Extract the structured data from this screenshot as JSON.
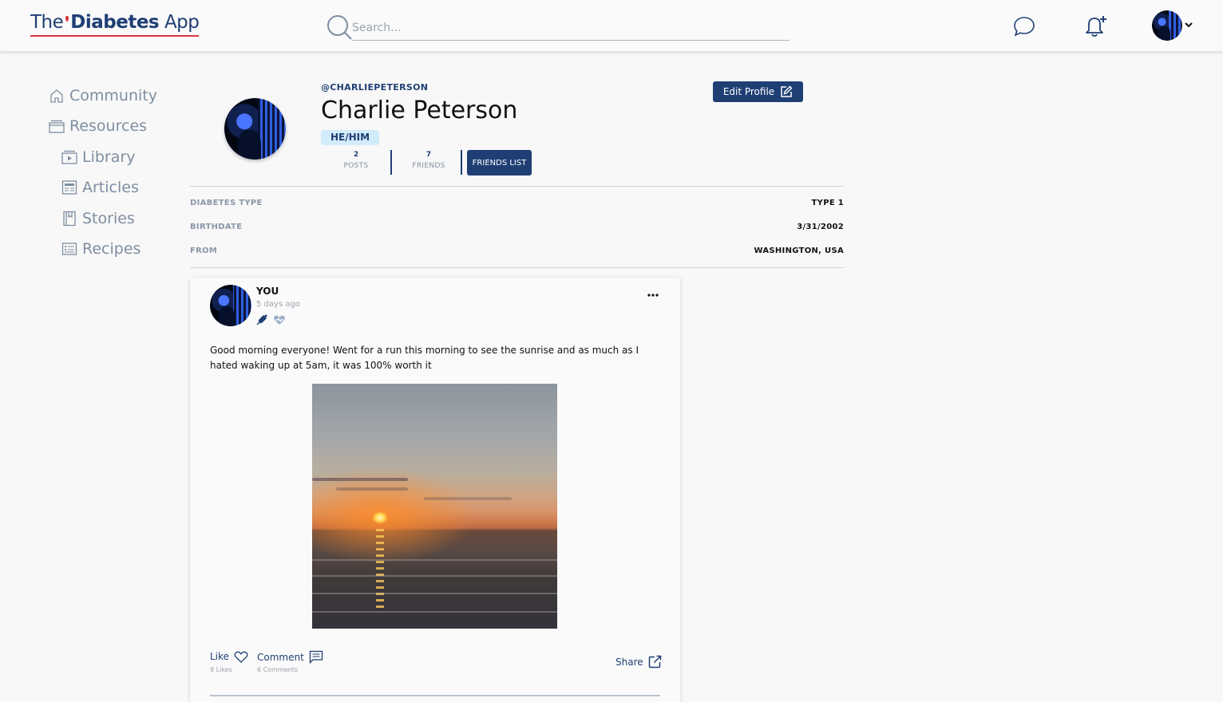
{
  "app": {
    "logo_the": "The",
    "logo_diabetes": "Diabetes",
    "logo_app": "App"
  },
  "search": {
    "placeholder": "Search..."
  },
  "sidebar": {
    "items": [
      {
        "label": "Community",
        "icon": "home-icon"
      },
      {
        "label": "Resources",
        "icon": "folder-icon"
      },
      {
        "label": "Library",
        "icon": "video-icon"
      },
      {
        "label": "Articles",
        "icon": "newspaper-icon"
      },
      {
        "label": "Stories",
        "icon": "book-icon"
      },
      {
        "label": "Recipes",
        "icon": "recipe-card-icon"
      }
    ]
  },
  "profile": {
    "handle": "@CHARLIEPETERSON",
    "name": "Charlie Peterson",
    "pronouns": "HE/HIM",
    "posts_count": "2",
    "posts_label": "POSTS",
    "friends_count": "7",
    "friends_label": "FRIENDS",
    "friends_list_label": "FRIENDS LIST",
    "edit_label": "Edit Profile"
  },
  "details": [
    {
      "label": "DIABETES TYPE",
      "value": "TYPE 1"
    },
    {
      "label": "BIRTHDATE",
      "value": "3/31/2002"
    },
    {
      "label": "FROM",
      "value": "WASHINGTON, USA"
    }
  ],
  "post": {
    "author": "YOU",
    "time": "5 days ago",
    "text": "Good morning everyone! Went for a run this morning to see the sunrise and as much as I hated waking up at 5am, it was 100% worth it",
    "like_label": "Like",
    "likes": "9 Likes",
    "comment_label": "Comment",
    "comments": "6 Comments",
    "share_label": "Share"
  },
  "colors": {
    "primary": "#1f3f74",
    "accent_red": "#d9343c",
    "muted": "#7e8ea1",
    "pronoun_bg": "#d3ecfb"
  }
}
